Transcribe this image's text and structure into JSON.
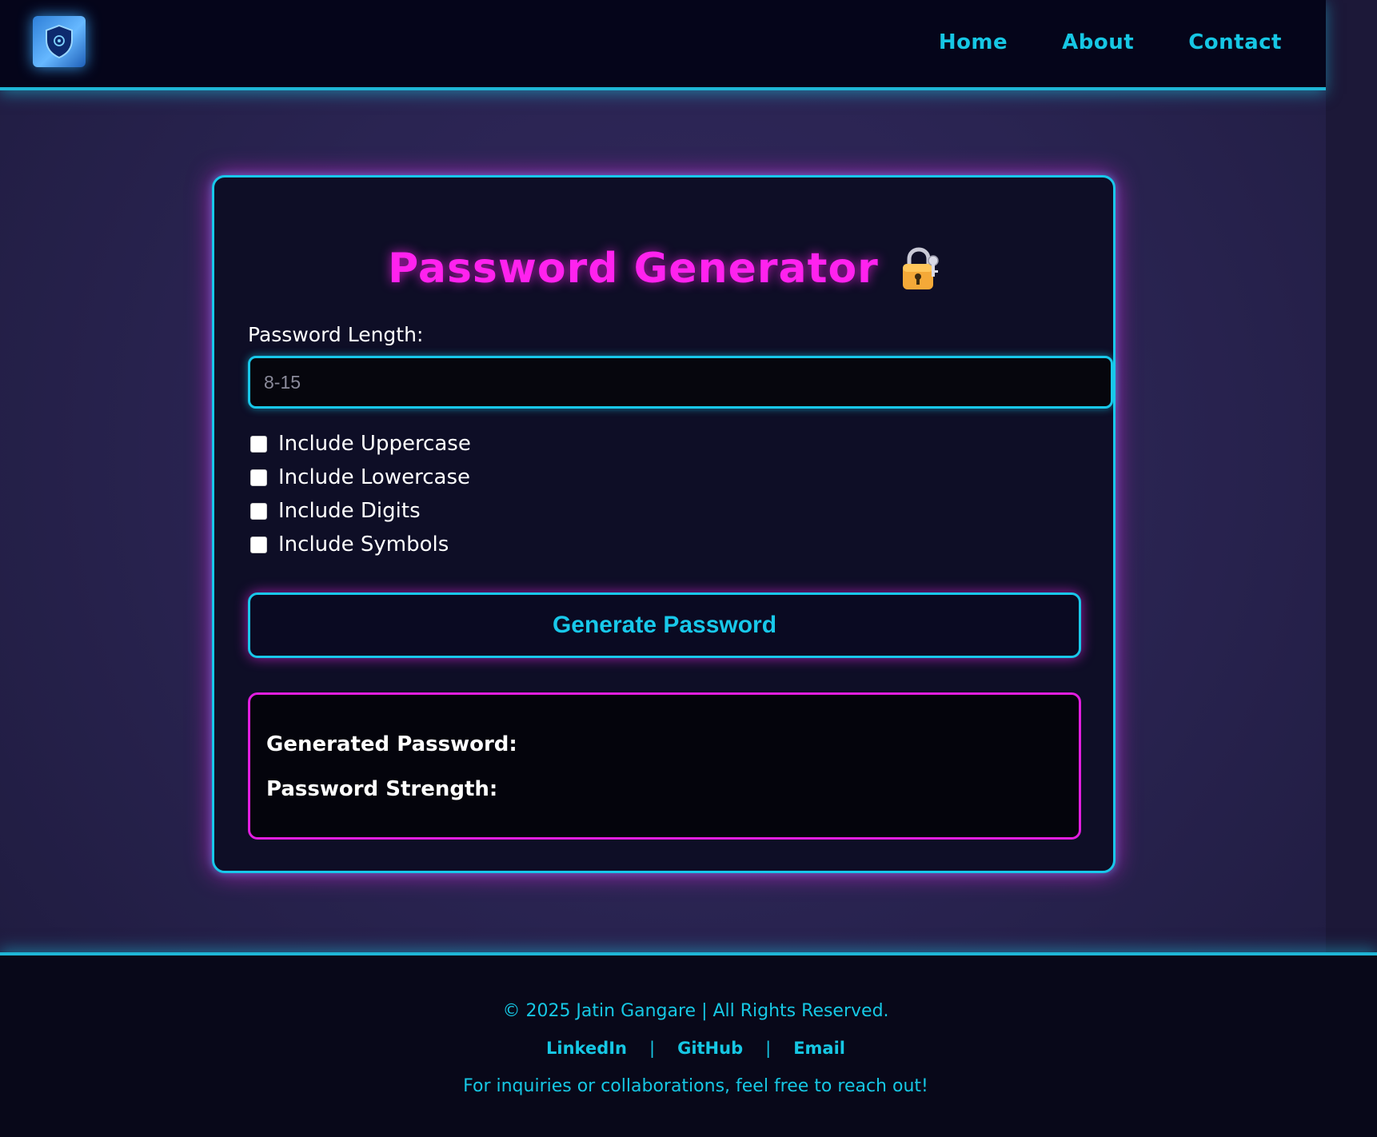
{
  "colors": {
    "accent_cyan": "#18c8ea",
    "accent_magenta": "#ff22ee",
    "header_bg": "#05051a",
    "card_bg": "#0e0e26"
  },
  "header": {
    "logo_icon": "shield-icon",
    "nav": [
      {
        "label": "Home"
      },
      {
        "label": "About"
      },
      {
        "label": "Contact"
      }
    ]
  },
  "main": {
    "title": "Password Generator",
    "title_icon": "lock-key-icon",
    "length_label": "Password Length:",
    "length_placeholder": "8-15",
    "options": [
      {
        "label": "Include Uppercase",
        "checked": false
      },
      {
        "label": "Include Lowercase",
        "checked": false
      },
      {
        "label": "Include Digits",
        "checked": false
      },
      {
        "label": "Include Symbols",
        "checked": false
      }
    ],
    "generate_label": "Generate Password",
    "result": {
      "password_label": "Generated Password:",
      "strength_label": "Password Strength:"
    }
  },
  "footer": {
    "copyright": "© 2025 Jatin Gangare | All Rights Reserved.",
    "links": [
      {
        "label": "LinkedIn"
      },
      {
        "label": "GitHub"
      },
      {
        "label": "Email"
      }
    ],
    "separator": "|",
    "note": "For inquiries or collaborations, feel free to reach out!"
  }
}
